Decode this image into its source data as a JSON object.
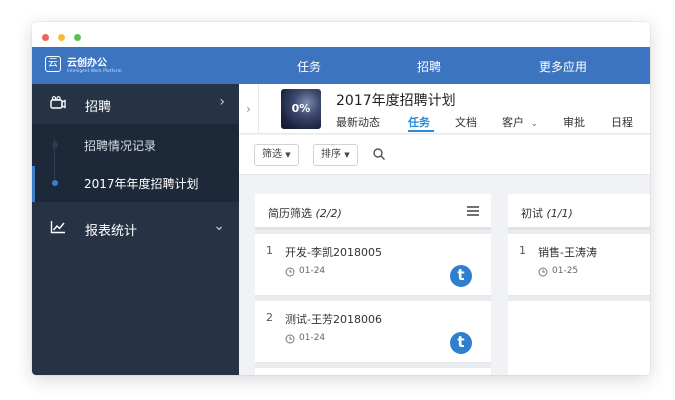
{
  "brand": {
    "name": "云创办公",
    "tagline": "Intelligent Work Platform",
    "logo_glyph": "云"
  },
  "topnav": {
    "items": [
      {
        "label": "任务"
      },
      {
        "label": "招聘"
      },
      {
        "label": "更多应用"
      }
    ]
  },
  "sidebar": {
    "groups": [
      {
        "label": "招聘",
        "icon": "camera-icon",
        "expanded": true
      },
      {
        "label": "报表统计",
        "icon": "chart-icon",
        "expanded": false
      }
    ],
    "subitems": [
      {
        "label": "招聘情况记录",
        "active": false
      },
      {
        "label": "2017年年度招聘计划",
        "active": true
      }
    ]
  },
  "project": {
    "progress_label": "0%",
    "progress": 0,
    "title": "2017年度招聘计划",
    "tabs": [
      {
        "label": "最新动态"
      },
      {
        "label": "任务",
        "active": true
      },
      {
        "label": "文档"
      },
      {
        "label": "客户"
      },
      {
        "label": "审批"
      },
      {
        "label": "日程"
      }
    ]
  },
  "toolbar": {
    "filter_label": "筛选",
    "sort_label": "排序"
  },
  "columns": [
    {
      "title": "简历筛选",
      "count": "(2/2)",
      "cards": [
        {
          "num": "1",
          "title": "开发-李凯2018005",
          "date": "01-24",
          "avatar": "t"
        },
        {
          "num": "2",
          "title": "测试-王芳2018006",
          "date": "01-24",
          "avatar": "t"
        }
      ]
    },
    {
      "title": "初试",
      "count": "(1/1)",
      "cards": [
        {
          "num": "1",
          "title": "销售-王涛涛",
          "date": "01-25"
        }
      ]
    }
  ],
  "colors": {
    "nav_blue": "#3c74c0",
    "sidebar": "#263345",
    "accent": "#2a8bd7",
    "avatar": "#2e7fd0"
  }
}
